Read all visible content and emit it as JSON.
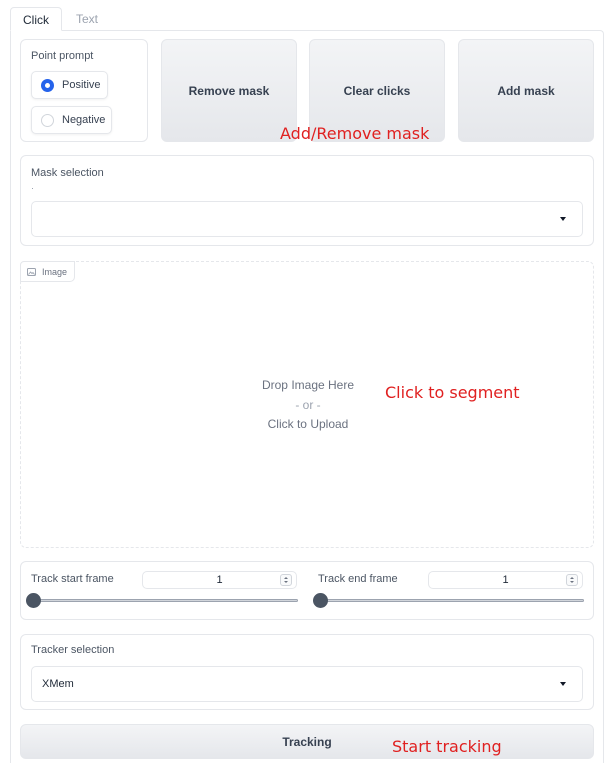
{
  "tabs": [
    {
      "label": "Click",
      "active": true
    },
    {
      "label": "Text",
      "active": false
    }
  ],
  "point_prompt": {
    "label": "Point prompt",
    "options": [
      {
        "label": "Positive",
        "selected": true
      },
      {
        "label": "Negative",
        "selected": false
      }
    ]
  },
  "buttons": {
    "remove_mask": "Remove mask",
    "clear_clicks": "Clear clicks",
    "add_mask": "Add mask",
    "tracking": "Tracking"
  },
  "annotations": {
    "add_remove_mask": "Add/Remove mask",
    "click_to_segment": "Click to segment",
    "start_tracking": "Start tracking"
  },
  "mask_selection": {
    "label": "Mask selection",
    "value": ""
  },
  "image_upload": {
    "label": "Image",
    "drop_text": "Drop Image Here",
    "or_text": "- or -",
    "upload_text": "Click to Upload"
  },
  "track_start": {
    "label": "Track start frame",
    "value": "1",
    "slider_fraction": 0.0
  },
  "track_end": {
    "label": "Track end frame",
    "value": "1",
    "slider_fraction": 0.0
  },
  "tracker_selection": {
    "label": "Tracker selection",
    "value": "XMem"
  },
  "colors": {
    "accent": "#2563eb",
    "annotation": "#e02020"
  },
  "icons": {
    "image_chip": "image-icon",
    "select_caret": "chevron-down-icon"
  }
}
